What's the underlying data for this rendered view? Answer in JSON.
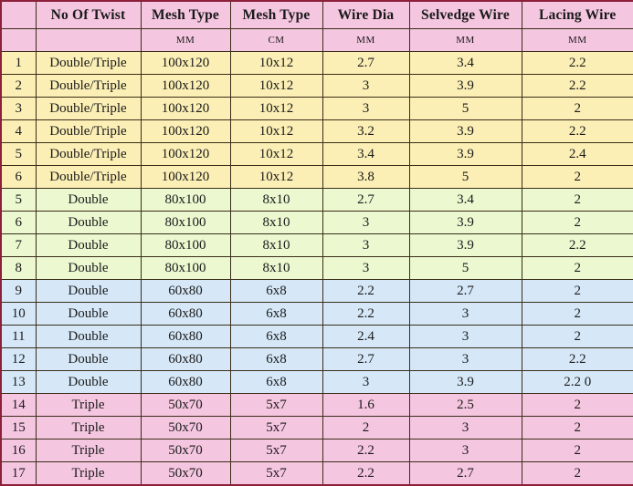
{
  "table": {
    "headers": [
      "",
      "No Of Twist",
      "Mesh Type",
      "Mesh Type",
      "Wire Dia",
      "Selvedge Wire",
      "Lacing Wire"
    ],
    "units": [
      "",
      "",
      "MM",
      "CM",
      "MM",
      "MM",
      "MM"
    ],
    "colors": {
      "header_background": "#f5c6e0",
      "group_yellow": "#fbefb5",
      "group_green": "#ebf8d0",
      "group_blue": "#d6e8f8",
      "group_pink": "#f5c6e0",
      "outer_border": "#8c1f3a",
      "cell_border": "#3a2d1a"
    },
    "rows": [
      {
        "group": "yellow",
        "sl": "1",
        "twist": "Double/Triple",
        "mesh_mm": "100x120",
        "mesh_cm": "10x12",
        "wire_dia": "2.7",
        "selvedge": "3.4",
        "lacing": "2.2"
      },
      {
        "group": "yellow",
        "sl": "2",
        "twist": "Double/Triple",
        "mesh_mm": "100x120",
        "mesh_cm": "10x12",
        "wire_dia": "3",
        "selvedge": "3.9",
        "lacing": "2.2"
      },
      {
        "group": "yellow",
        "sl": "3",
        "twist": "Double/Triple",
        "mesh_mm": "100x120",
        "mesh_cm": "10x12",
        "wire_dia": "3",
        "selvedge": "5",
        "lacing": "2"
      },
      {
        "group": "yellow",
        "sl": "4",
        "twist": "Double/Triple",
        "mesh_mm": "100x120",
        "mesh_cm": "10x12",
        "wire_dia": "3.2",
        "selvedge": "3.9",
        "lacing": "2.2"
      },
      {
        "group": "yellow",
        "sl": "5",
        "twist": "Double/Triple",
        "mesh_mm": "100x120",
        "mesh_cm": "10x12",
        "wire_dia": "3.4",
        "selvedge": "3.9",
        "lacing": "2.4"
      },
      {
        "group": "yellow",
        "sl": "6",
        "twist": "Double/Triple",
        "mesh_mm": "100x120",
        "mesh_cm": "10x12",
        "wire_dia": "3.8",
        "selvedge": "5",
        "lacing": "2"
      },
      {
        "group": "green",
        "sl": "5",
        "twist": "Double",
        "mesh_mm": "80x100",
        "mesh_cm": "8x10",
        "wire_dia": "2.7",
        "selvedge": "3.4",
        "lacing": "2"
      },
      {
        "group": "green",
        "sl": "6",
        "twist": "Double",
        "mesh_mm": "80x100",
        "mesh_cm": "8x10",
        "wire_dia": "3",
        "selvedge": "3.9",
        "lacing": "2"
      },
      {
        "group": "green",
        "sl": "7",
        "twist": "Double",
        "mesh_mm": "80x100",
        "mesh_cm": "8x10",
        "wire_dia": "3",
        "selvedge": "3.9",
        "lacing": "2.2"
      },
      {
        "group": "green",
        "sl": "8",
        "twist": "Double",
        "mesh_mm": "80x100",
        "mesh_cm": "8x10",
        "wire_dia": "3",
        "selvedge": "5",
        "lacing": "2"
      },
      {
        "group": "blue",
        "sl": "9",
        "twist": "Double",
        "mesh_mm": "60x80",
        "mesh_cm": "6x8",
        "wire_dia": "2.2",
        "selvedge": "2.7",
        "lacing": "2"
      },
      {
        "group": "blue",
        "sl": "10",
        "twist": "Double",
        "mesh_mm": "60x80",
        "mesh_cm": "6x8",
        "wire_dia": "2.2",
        "selvedge": "3",
        "lacing": "2"
      },
      {
        "group": "blue",
        "sl": "11",
        "twist": "Double",
        "mesh_mm": "60x80",
        "mesh_cm": "6x8",
        "wire_dia": "2.4",
        "selvedge": "3",
        "lacing": "2"
      },
      {
        "group": "blue",
        "sl": "12",
        "twist": "Double",
        "mesh_mm": "60x80",
        "mesh_cm": "6x8",
        "wire_dia": "2.7",
        "selvedge": "3",
        "lacing": "2.2"
      },
      {
        "group": "blue",
        "sl": "13",
        "twist": "Double",
        "mesh_mm": "60x80",
        "mesh_cm": "6x8",
        "wire_dia": "3",
        "selvedge": "3.9",
        "lacing": "2.2 0"
      },
      {
        "group": "pink",
        "sl": "14",
        "twist": "Triple",
        "mesh_mm": "50x70",
        "mesh_cm": "5x7",
        "wire_dia": "1.6",
        "selvedge": "2.5",
        "lacing": "2"
      },
      {
        "group": "pink",
        "sl": "15",
        "twist": "Triple",
        "mesh_mm": "50x70",
        "mesh_cm": "5x7",
        "wire_dia": "2",
        "selvedge": "3",
        "lacing": "2"
      },
      {
        "group": "pink",
        "sl": "16",
        "twist": "Triple",
        "mesh_mm": "50x70",
        "mesh_cm": "5x7",
        "wire_dia": "2.2",
        "selvedge": "3",
        "lacing": "2"
      },
      {
        "group": "pink",
        "sl": "17",
        "twist": "Triple",
        "mesh_mm": "50x70",
        "mesh_cm": "5x7",
        "wire_dia": "2.2",
        "selvedge": "2.7",
        "lacing": "2"
      }
    ]
  }
}
